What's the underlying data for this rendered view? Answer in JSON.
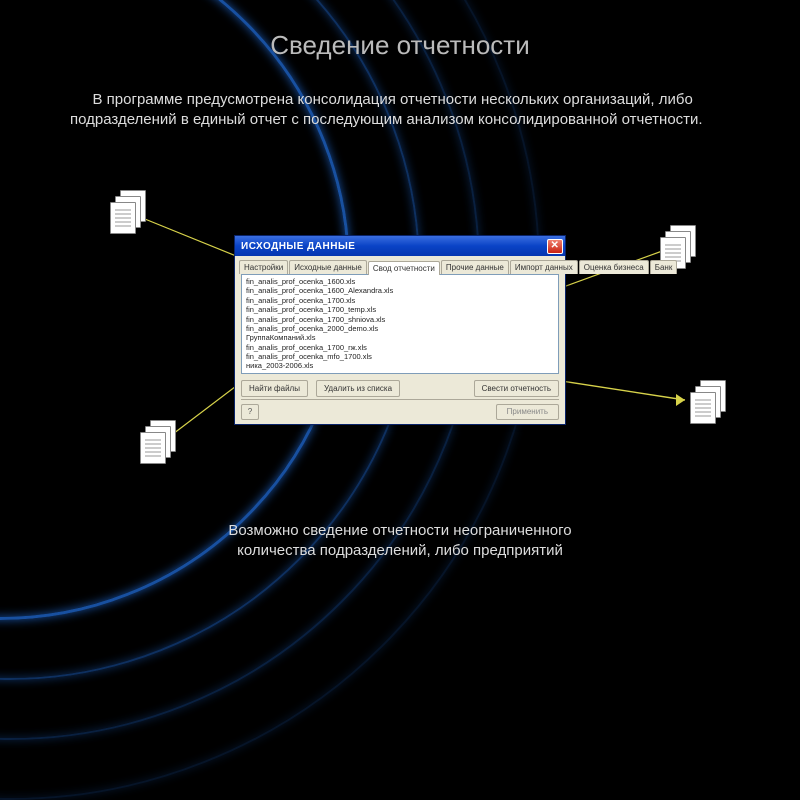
{
  "title": "Сведение отчетности",
  "description": "В программе предусмотрена консолидация отчетности нескольких организаций, либо подразделений в единый отчет с последующим анализом консолидированной отчетности.",
  "footer_line1": "Возможно сведение отчетности неограниченного",
  "footer_line2": "количества подразделений, либо предприятий",
  "window": {
    "title": "ИСХОДНЫЕ ДАННЫЕ",
    "tabs": {
      "t1": "Настройки",
      "t2": "Исходные данные",
      "t3": "Свод отчетности",
      "t4": "Прочие данные",
      "t5": "Импорт данных",
      "t6": "Оценка бизнеса",
      "t7": "Банк"
    },
    "files": {
      "f1": "fin_analis_prof_ocenka_1600.xls",
      "f2": "fin_analis_prof_ocenka_1600_Alexandra.xls",
      "f3": "fin_analis_prof_ocenka_1700.xls",
      "f4": "fin_analis_prof_ocenka_1700_temp.xls",
      "f5": "fin_analis_prof_ocenka_1700_shniova.xls",
      "f6": "fin_analis_prof_ocenka_2000_demo.xls",
      "f7": "ГруппаКомпаний.xls",
      "f8": "fin_analis_prof_ocenka_1700_rж.xls",
      "f9": "fin_analis_prof_ocenka_mfo_1700.xls",
      "f10": "ника_2003-2006.xls"
    },
    "buttons": {
      "find": "Найти файлы",
      "remove": "Удалить из списка",
      "consolidate": "Свести отчетность",
      "apply": "Применить"
    }
  }
}
